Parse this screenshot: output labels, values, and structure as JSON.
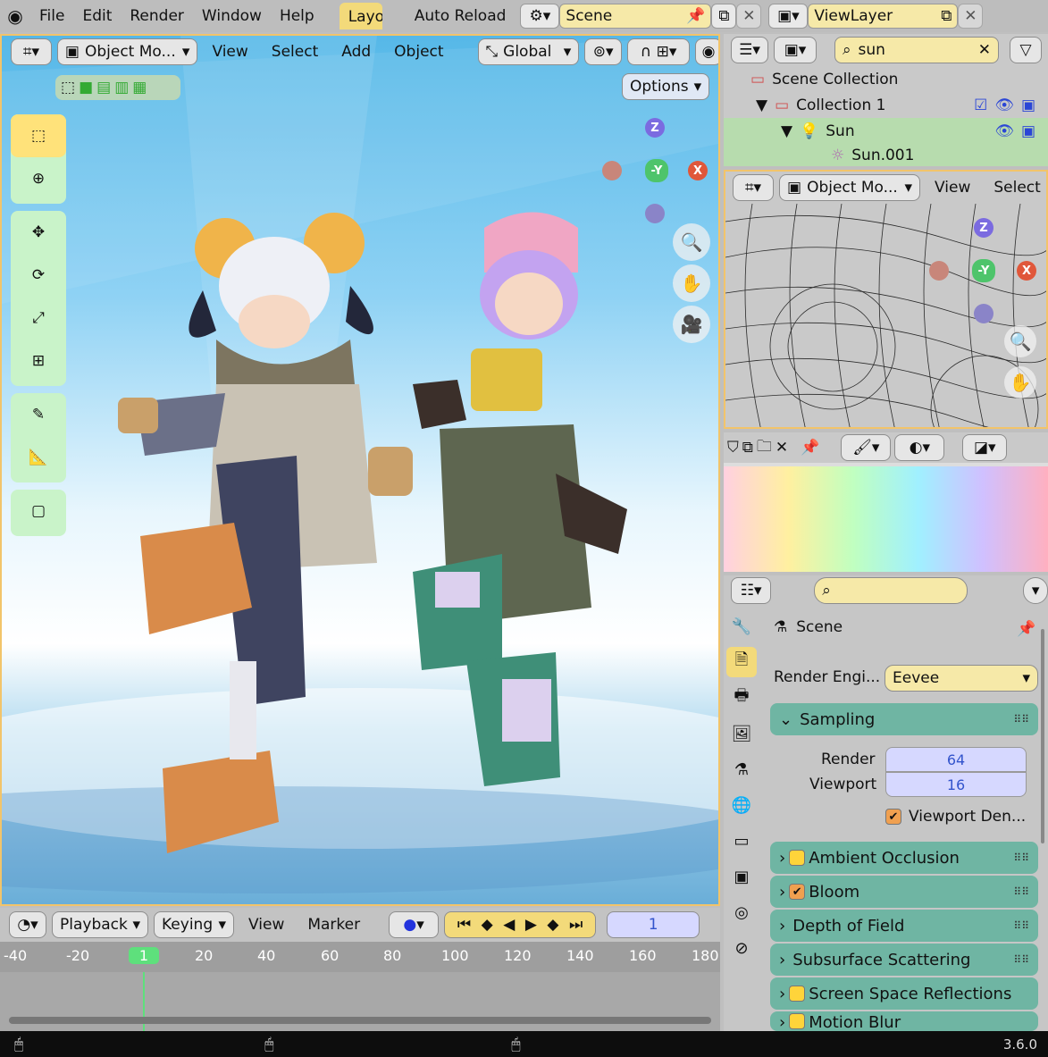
{
  "app": {
    "version": "3.6.0"
  },
  "topbar": {
    "menu": [
      "File",
      "Edit",
      "Render",
      "Window",
      "Help"
    ],
    "workspace_tab": "Layo",
    "auto_reload": "Auto Reload",
    "scene": "Scene",
    "view_layer": "ViewLayer"
  },
  "viewport": {
    "mode": "Object Mo...",
    "menus": [
      "View",
      "Select",
      "Add",
      "Object"
    ],
    "orientation": "Global",
    "options": "Options",
    "gizmo": {
      "z": "Z",
      "y": "-Y",
      "x": "X"
    }
  },
  "timeline": {
    "menus": [
      "Playback",
      "Keying",
      "View",
      "Marker"
    ],
    "current_frame": "1",
    "ticks": [
      "-40",
      "-20",
      "1",
      "20",
      "40",
      "60",
      "80",
      "100",
      "120",
      "140",
      "160",
      "180"
    ]
  },
  "outliner": {
    "search_value": "sun",
    "rows": [
      {
        "label": "Scene Collection"
      },
      {
        "label": "Collection 1"
      },
      {
        "label": "Sun"
      },
      {
        "label": "Sun.001"
      }
    ]
  },
  "wireframe_view": {
    "mode": "Object Mo...",
    "menus": [
      "View",
      "Select"
    ],
    "gizmo": {
      "z": "Z",
      "y": "-Y",
      "x": "X"
    }
  },
  "properties": {
    "context": "Scene",
    "render_engine_label": "Render Engi...",
    "render_engine_value": "Eevee",
    "sampling": {
      "title": "Sampling",
      "render_label": "Render",
      "render_value": "64",
      "viewport_label": "Viewport",
      "viewport_value": "16",
      "denoise_label": "Viewport Den..."
    },
    "panels": [
      {
        "label": "Ambient Occlusion",
        "checkbox": true,
        "checked": false
      },
      {
        "label": "Bloom",
        "checkbox": true,
        "checked": true
      },
      {
        "label": "Depth of Field",
        "checkbox": false,
        "checked": false
      },
      {
        "label": "Subsurface Scattering",
        "checkbox": false,
        "checked": false
      },
      {
        "label": "Screen Space Reflections",
        "checkbox": true,
        "checked": false
      },
      {
        "label": "Motion Blur",
        "checkbox": true,
        "checked": false
      }
    ]
  },
  "colors": {
    "accent": "#f3da7a",
    "panel": "#6fb5a3",
    "tool_bg": "#c9f3c9",
    "number_text": "#3354cc"
  }
}
